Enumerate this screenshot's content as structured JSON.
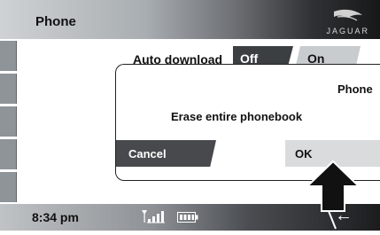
{
  "header": {
    "title": "Phone",
    "logo_text": "JAGUAR"
  },
  "setting": {
    "label": "Auto download",
    "options": [
      "Off",
      "On"
    ],
    "selected": "Off"
  },
  "dialog": {
    "title": "Phone",
    "message": "Erase entire phonebook",
    "cancel_label": "Cancel",
    "ok_label": "OK"
  },
  "status": {
    "time": "8:34 pm"
  },
  "icons": [
    "signal-icon",
    "battery-icon",
    "back-arrow-icon",
    "pointer-arrow-icon",
    "jaguar-logo-icon"
  ]
}
